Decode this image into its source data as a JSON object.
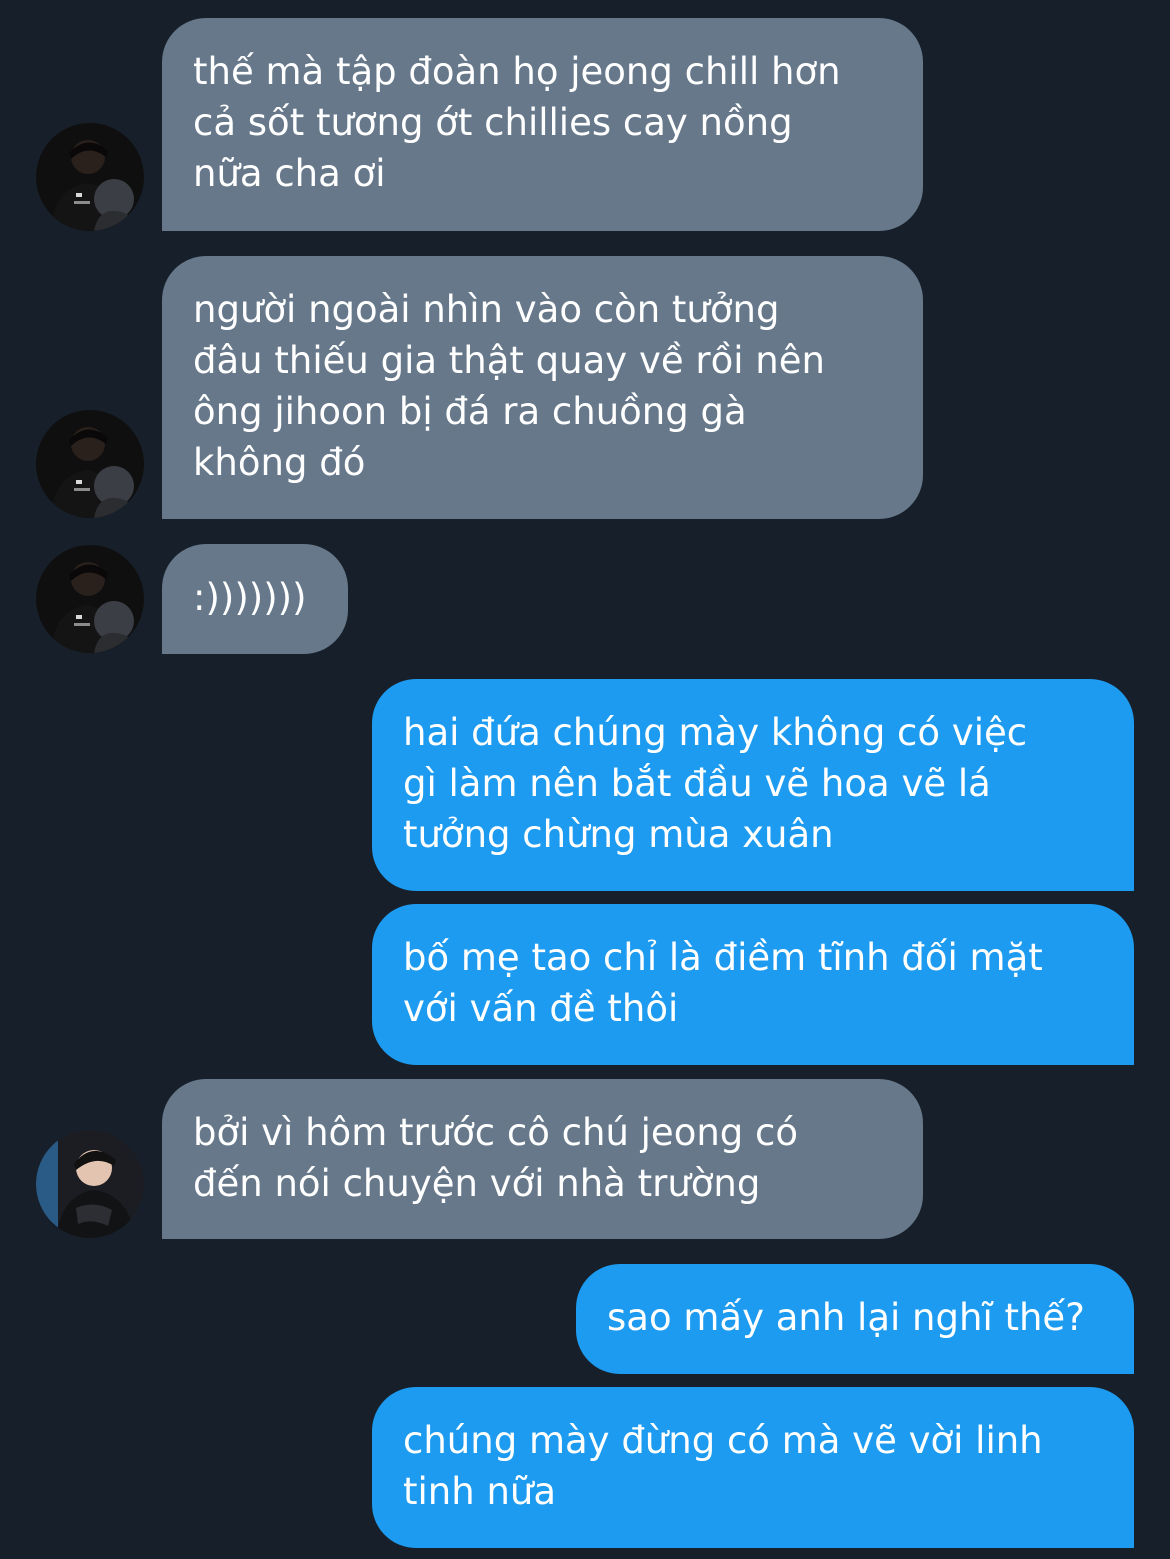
{
  "messages": [
    {
      "side": "incoming",
      "text": "thế mà tập đoàn họ jeong chill hơn\ncả sốt tương ớt chillies cay nồng\nnữa cha ơi",
      "avatar": "user-a"
    },
    {
      "side": "incoming",
      "text": "người ngoài nhìn vào còn tưởng\nđâu thiếu gia thật quay về rồi nên\nông jihoon bị đá ra chuồng gà\nkhông đó",
      "avatar": "user-a"
    },
    {
      "side": "incoming",
      "text": ":)))))))",
      "avatar": "user-a"
    },
    {
      "side": "outgoing",
      "text": "hai đứa chúng mày không có việc\ngì làm nên bắt đầu vẽ hoa vẽ lá\ntưởng chừng mùa xuân"
    },
    {
      "side": "outgoing",
      "text": "bố mẹ tao chỉ là điềm tĩnh đối mặt\nvới vấn đề thôi"
    },
    {
      "side": "incoming",
      "text": "bởi vì hôm trước cô chú jeong có\nđến nói chuyện với nhà trường",
      "avatar": "user-b"
    },
    {
      "side": "outgoing",
      "text": "sao mấy anh lại nghĩ thế?"
    },
    {
      "side": "outgoing",
      "text": "chúng mày đừng có mà vẽ vời linh\ntinh nữa"
    }
  ],
  "colors": {
    "background": "#17202a",
    "incoming_bubble": "#66788a",
    "outgoing_bubble": "#1d9bf0",
    "text": "#ffffff"
  }
}
